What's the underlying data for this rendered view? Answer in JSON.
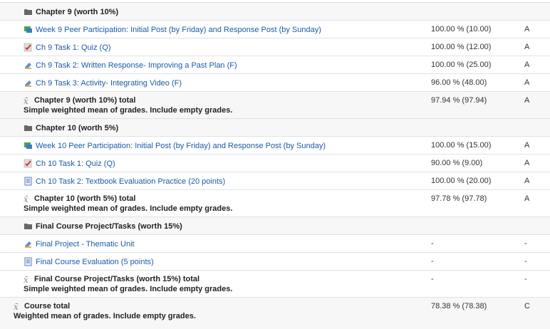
{
  "chapter9": {
    "category": "Chapter 9 (worth 10%)",
    "items": [
      {
        "name": "Week 9 Peer Participation: Initial Post (by Friday) and Response Post (by Sunday)",
        "percent": "100.00 % (10.00)",
        "letter": "A",
        "icon": "forum-icon"
      },
      {
        "name": "Ch 9 Task 1: Quiz (Q)",
        "percent": "100.00 % (12.00)",
        "letter": "A",
        "icon": "quiz-icon"
      },
      {
        "name": "Ch 9 Task 2: Written Response- Improving a Past Plan (F)",
        "percent": "100.00 % (25.00)",
        "letter": "A",
        "icon": "assignment-icon"
      },
      {
        "name": "Ch 9 Task 3: Activity- Integrating Video (F)",
        "percent": "96.00 % (48.00)",
        "letter": "A",
        "icon": "assignment-icon"
      }
    ],
    "total_name": "Chapter 9 (worth 10%) total",
    "total_desc": "Simple weighted mean of grades. Include empty grades.",
    "total_percent": "97.94 % (97.94)",
    "total_letter": "A"
  },
  "chapter10": {
    "category": "Chapter 10 (worth 5%)",
    "items": [
      {
        "name": "Week 10 Peer Participation: Initial Post (by Friday) and Response Post (by Sunday)",
        "percent": "100.00 % (15.00)",
        "letter": "A",
        "icon": "forum-icon"
      },
      {
        "name": "Ch 10 Task 1: Quiz (Q)",
        "percent": "90.00 % (9.00)",
        "letter": "A",
        "icon": "quiz-icon"
      },
      {
        "name": "Ch 10 Task 2: Textbook Evaluation Practice (20 points)",
        "percent": "100.00 % (20.00)",
        "letter": "A",
        "icon": "document-icon"
      }
    ],
    "total_name": "Chapter 10 (worth 5%) total",
    "total_desc": "Simple weighted mean of grades. Include empty grades.",
    "total_percent": "97.78 % (97.78)",
    "total_letter": "A"
  },
  "final_project": {
    "category": "Final Course Project/Tasks (worth 15%)",
    "items": [
      {
        "name": "Final Project - Thematic Unit",
        "percent": "-",
        "letter": "-",
        "icon": "assignment-icon"
      },
      {
        "name": "Final Course Evaluation (5 points)",
        "percent": "-",
        "letter": "-",
        "icon": "document-icon"
      }
    ],
    "total_name": "Final Course Project/Tasks (worth 15%) total",
    "total_desc": "Simple weighted mean of grades. Include empty grades.",
    "total_percent": "-",
    "total_letter": "-"
  },
  "course_total": {
    "name": "Course total",
    "desc": "Weighted mean of grades. Include empty grades.",
    "percent": "78.38 % (78.38)",
    "letter": "C"
  },
  "colors": {
    "link": "#1a5aa8",
    "category_bg": "#f7f7f7",
    "border": "#dee2e6"
  }
}
